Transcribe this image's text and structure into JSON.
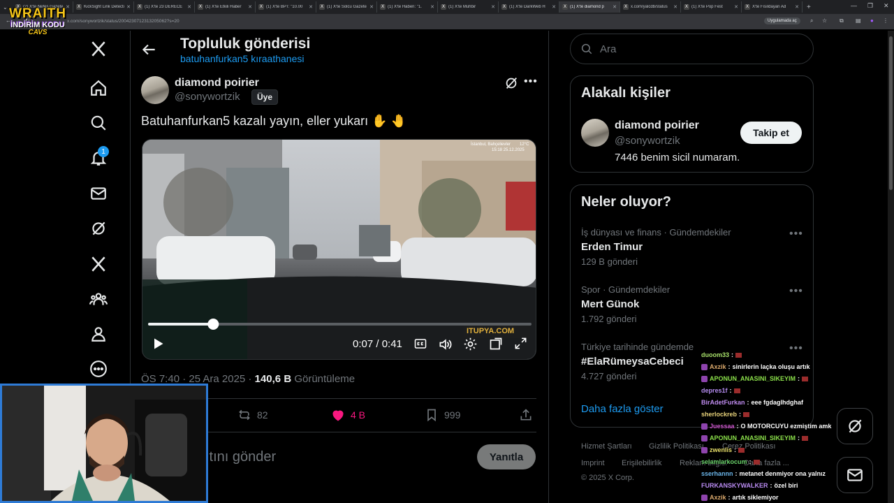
{
  "browser": {
    "tabs": [
      {
        "label": "(2) X'te Nefes Gazete"
      },
      {
        "label": "KickSight Link Detector"
      },
      {
        "label": "(1) X'te 23 DERECE"
      },
      {
        "label": "(1) X'te Etkili Haber"
      },
      {
        "label": "(1) X'te BPT: \"10.00"
      },
      {
        "label": "(1) X'te Solcu Gazete"
      },
      {
        "label": "(1) X'te Haberi: \"1."
      },
      {
        "label": "(1) X'te Muhbir"
      },
      {
        "label": "(1) X'te DarkWeb H"
      },
      {
        "label": "(1) X'te diamond p"
      },
      {
        "label": "x.com/yalcdb/status"
      },
      {
        "label": "(1) X'te Pop Fest"
      },
      {
        "label": "X'te Fısıldayan Ad"
      }
    ],
    "url": "x.com/sonywortzik/status/2004230712313205062?s=20",
    "app_button": "Uygulamada aç"
  },
  "stream_overlay": {
    "logo_top": "WRAITH",
    "logo_mid": "İNDİRİM KODU",
    "logo_bottom": "CAVS"
  },
  "nav": {
    "notification_count": "1"
  },
  "header": {
    "title": "Topluluk gönderisi",
    "subtitle": "batuhanfurkan5 kıraathanesi"
  },
  "post": {
    "display_name": "diamond poirier",
    "handle": "@sonywortzik",
    "member_badge": "Üye",
    "text": "Batuhanfurkan5 kazalı yayın, eller yukarı ✋ 🤚",
    "video": {
      "time": "0:07 / 0:41",
      "progress": 0.17,
      "watermark": "ITUPYA.COM",
      "location": "İstanbul, Bahçelievler",
      "temp": "12°C",
      "timestamp": "15:18  25.12.2025"
    },
    "time": "ÖS 7:40 · 25 Ara 2025 · ",
    "views": "140,6 B",
    "views_label": " Görüntüleme",
    "retweets": "82",
    "likes": "4 B",
    "bookmarks": "999",
    "reply_placeholder": "ıtını gönder",
    "reply_button": "Yanıtla"
  },
  "search": {
    "placeholder": "Ara"
  },
  "related": {
    "title": "Alakalı kişiler",
    "name": "diamond poirier",
    "handle": "@sonywortzik",
    "bio": "7446 benim sicil numaram.",
    "follow_button": "Takip et"
  },
  "trends": {
    "title": "Neler oluyor?",
    "items": [
      {
        "category": "İş dünyası ve finans · Gündemdekiler",
        "name": "Erden Timur",
        "count": "129 B gönderi"
      },
      {
        "category": "Spor · Gündemdekiler",
        "name": "Mert Günok",
        "count": "1.792 gönderi"
      },
      {
        "category": "Türkiye tarihinde gündemde",
        "name": "#ElaRümeysaCebeci",
        "count": "4.727 gönderi"
      }
    ],
    "show_more": "Daha fazla göster"
  },
  "footer": {
    "links": [
      "Hizmet Şartları",
      "Gizlilik Politikası",
      "Çerez Politikası",
      "Imprint",
      "Erişilebilirlik",
      "Reklam bilgisi",
      "Daha fazla ..."
    ],
    "copyright": "© 2025 X Corp."
  },
  "chat": [
    {
      "user": "duoom33",
      "msg": "",
      "color": "#a8e06a",
      "badge": false,
      "emote": true
    },
    {
      "user": "Axzik",
      "msg": "sinirlerin laçka oluşu artık",
      "color": "#d9a86c",
      "badge": true,
      "emote": false
    },
    {
      "user": "APONUN_ANASINI_SIKEYIM",
      "msg": "",
      "color": "#8be04a",
      "badge": true,
      "emote": true
    },
    {
      "user": "depres1f",
      "msg": "",
      "color": "#b58cf0",
      "badge": false,
      "emote": true
    },
    {
      "user": "BirAdetFurkan",
      "msg": "eee fgdaglhdghaf",
      "color": "#c08cf0",
      "badge": false,
      "emote": false
    },
    {
      "user": "sherlockreb",
      "msg": "",
      "color": "#e8d27a",
      "badge": false,
      "emote": true
    },
    {
      "user": "Juessaa",
      "msg": "O MOTORCUYU ezmiştim amk",
      "color": "#d25ad2",
      "badge": true,
      "emote": false
    },
    {
      "user": "APONUN_ANASINI_SIKEYIM",
      "msg": "",
      "color": "#8be04a",
      "badge": true,
      "emote": true
    },
    {
      "user": "zwenlis",
      "msg": "",
      "color": "#e8e06a",
      "badge": true,
      "emote": true
    },
    {
      "user": "selamlarkocum",
      "msg": "",
      "color": "#6ad26a",
      "badge": false,
      "emote": true
    },
    {
      "user": "sserhannn",
      "msg": "metanet denmiyor ona yalnız",
      "color": "#6ab4e8",
      "badge": false,
      "emote": false
    },
    {
      "user": "FURKANSKYWALKER",
      "msg": "özel biri",
      "color": "#b88af0",
      "badge": false,
      "emote": false
    },
    {
      "user": "Axzik",
      "msg": "artık siklemiyor",
      "color": "#d9a86c",
      "badge": true,
      "emote": false
    }
  ],
  "colors": {
    "accent": "#1d9bf0",
    "like": "#f91880",
    "webcam_border": "#2e7bd6"
  }
}
